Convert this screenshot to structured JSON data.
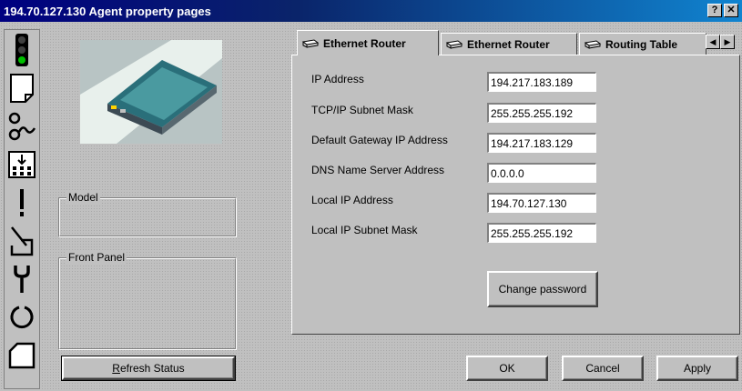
{
  "window": {
    "title": "194.70.127.130 Agent property pages",
    "help_glyph": "?",
    "close_glyph": "✕"
  },
  "toolbar": {
    "tools": [
      {
        "name": "traffic-light-icon"
      },
      {
        "name": "page-icon"
      },
      {
        "name": "link-icon"
      },
      {
        "name": "import-icon"
      },
      {
        "name": "alert-icon"
      },
      {
        "name": "slope-icon"
      },
      {
        "name": "wrench-icon"
      },
      {
        "name": "reset-icon"
      },
      {
        "name": "folder-icon"
      }
    ]
  },
  "left": {
    "model_label": "Model",
    "front_panel_label": "Front Panel",
    "refresh_first": "R",
    "refresh_rest": "efresh Status"
  },
  "tabs": [
    {
      "label": "Ethernet Router",
      "active": true
    },
    {
      "label": "Ethernet Router",
      "active": false
    },
    {
      "label": "Routing Table",
      "active": false
    }
  ],
  "fields": [
    {
      "label": "IP Address",
      "value": "194.217.183.189"
    },
    {
      "label": "TCP/IP Subnet Mask",
      "value": "255.255.255.192"
    },
    {
      "label": "Default Gateway IP Address",
      "value": "194.217.183.129"
    },
    {
      "label": "DNS Name Server Address",
      "value": "0.0.0.0"
    },
    {
      "label": "Local IP Address",
      "value": "194.70.127.130"
    },
    {
      "label": "Local IP Subnet Mask",
      "value": "255.255.255.192"
    }
  ],
  "buttons": {
    "change_password": "Change password",
    "ok": "OK",
    "cancel": "Cancel",
    "apply": "Apply"
  },
  "colors": {
    "title_bar": "#000080",
    "face": "#c0c0c0",
    "traffic_green": "#00c000"
  }
}
